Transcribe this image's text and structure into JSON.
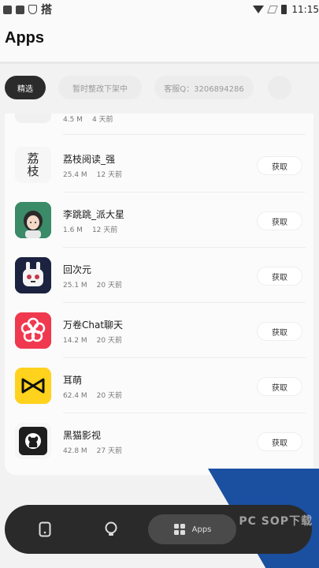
{
  "statusbar": {
    "left_text": "搭",
    "time": "11:15"
  },
  "header": {
    "title": "Apps"
  },
  "chips": [
    {
      "label": "精选",
      "active": true
    },
    {
      "label": "暂时整改下架中",
      "active": false
    },
    {
      "label": "客服Q：3206894286",
      "active": false
    },
    {
      "label": "",
      "active": false
    }
  ],
  "partial_app": {
    "size": "4.5 M",
    "time": "4 天前"
  },
  "apps": [
    {
      "name": "荔枝阅读_强",
      "size": "25.4 M",
      "time": "12 天前",
      "action": "获取",
      "icon": "litchi-icon",
      "icon_text": "荔\n枝"
    },
    {
      "name": "李跳跳_派大星",
      "size": "1.6 M",
      "time": "12 天前",
      "action": "获取",
      "icon": "cartoon-girl-icon",
      "icon_text": ""
    },
    {
      "name": "回次元",
      "size": "25.1 M",
      "time": "20 天前",
      "action": "获取",
      "icon": "robot-mascot-icon",
      "icon_text": ""
    },
    {
      "name": "万卷Chat聊天",
      "size": "14.2 M",
      "time": "20 天前",
      "action": "获取",
      "icon": "flower-icon",
      "icon_text": ""
    },
    {
      "name": "耳萌",
      "size": "62.4 M",
      "time": "20 天前",
      "action": "获取",
      "icon": "bowtie-icon",
      "icon_text": ""
    },
    {
      "name": "黑猫影视",
      "size": "42.8 M",
      "time": "27 天前",
      "action": "获取",
      "icon": "github-cat-icon",
      "icon_text": ""
    }
  ],
  "navbar": {
    "active_label": "Apps"
  },
  "colors": {
    "accent_dark": "#2b2b2b",
    "flower_red": "#f0394e",
    "bowtie_yellow": "#ffd21e",
    "overlay_blue": "#1b4fa0"
  },
  "watermark": "PC SOP下载"
}
